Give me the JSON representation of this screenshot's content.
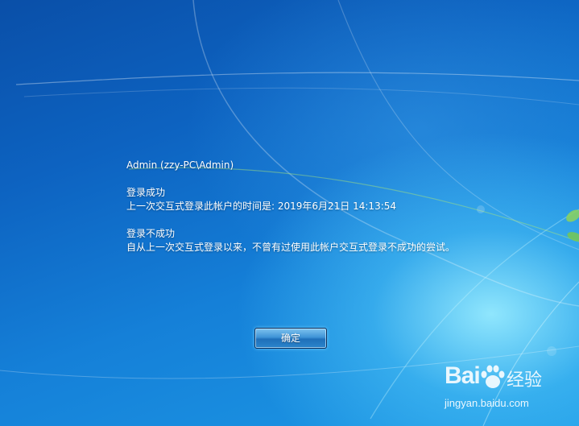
{
  "login_info": {
    "account": "Admin (zzy-PC\\Admin)",
    "success_heading": "登录成功",
    "last_login": "上一次交互式登录此帐户的时间是: 2019年6月21日 14:13:54",
    "failure_heading": "登录不成功",
    "failure_detail": "自从上一次交互式登录以来，不曾有过使用此帐户交互式登录不成功的尝试。"
  },
  "ok_button": {
    "label": "确定"
  },
  "watermark": {
    "brand": "Bai",
    "paw_icon": "baidu-paw-icon",
    "suffix": "经验",
    "url": "jingyan.baidu.com"
  },
  "colors": {
    "background_dark": "#0a4fa8",
    "background_light": "#1d9ae6",
    "glow": "#96ebff",
    "text": "#ffffff"
  }
}
